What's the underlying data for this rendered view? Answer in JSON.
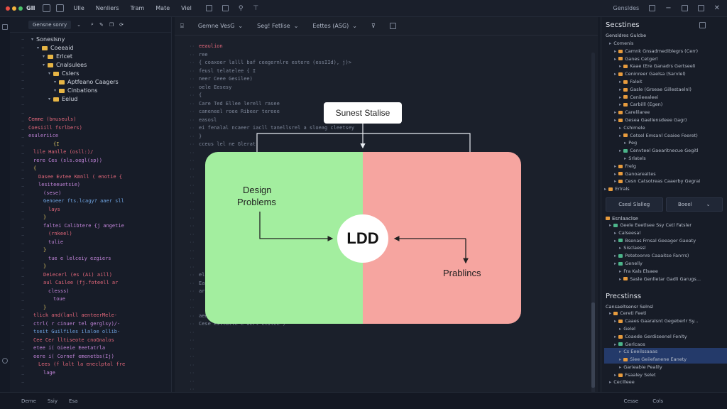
{
  "titlebar": {
    "app_name": "GII",
    "menu": [
      "Ulle",
      "Nenliers",
      "Tram",
      "Mate",
      "Viel"
    ],
    "right_label": "Gensldes",
    "dot_colors": [
      "#e94f45",
      "#f2b33d",
      "#4cc36b"
    ]
  },
  "explorer": {
    "header_label": "Gensne sonry",
    "tree": [
      {
        "label": "Soneslsny",
        "indent": 0,
        "folder": false
      },
      {
        "label": "Coeeaid",
        "indent": 1,
        "folder": true
      },
      {
        "label": "Erlcet",
        "indent": 2,
        "folder": true
      },
      {
        "label": "Cnalsulees",
        "indent": 2,
        "folder": true
      },
      {
        "label": "Cslers",
        "indent": 3,
        "folder": true
      },
      {
        "label": "Aptfeano Caagers",
        "indent": 4,
        "folder": true
      },
      {
        "label": "Cinbations",
        "indent": 4,
        "folder": true
      },
      {
        "label": "Eelud",
        "indent": 3,
        "folder": true
      }
    ],
    "code_lines": [
      {
        "t": "Cemme (bnuseuls)",
        "c": "c-red",
        "i": 0
      },
      {
        "t": "Coesiill fsrlbers)",
        "c": "c-red",
        "i": 0
      },
      {
        "t": "esuleriice",
        "c": "c-pur",
        "i": 0
      },
      {
        "t": "{I",
        "c": "c-yel",
        "i": 5
      },
      {
        "t": "lile Hanlle (osll:)/",
        "c": "c-red",
        "i": 1
      },
      {
        "t": "rere Ces (sls.oegl(sp))",
        "c": "c-pur",
        "i": 1
      },
      {
        "t": "{",
        "c": "c-yel",
        "i": 1
      },
      {
        "t": "Dasee Evtee Kmnll ( enotie {",
        "c": "c-red",
        "i": 2
      },
      {
        "t": "lesiteeuetsie)",
        "c": "c-pur",
        "i": 2
      },
      {
        "t": "(sese)",
        "c": "c-pur",
        "i": 3
      },
      {
        "t": "Genoeer fts.lcagy? aaer sll",
        "c": "c-blu",
        "i": 3
      },
      {
        "t": "lays",
        "c": "c-red",
        "i": 4
      },
      {
        "t": "}",
        "c": "c-yel",
        "i": 3
      },
      {
        "t": "faltei Calibtere {j angetie",
        "c": "c-pur",
        "i": 3
      },
      {
        "t": "(rnkeel)",
        "c": "c-red",
        "i": 4
      },
      {
        "t": "tulie",
        "c": "c-pur",
        "i": 4
      },
      {
        "t": "}",
        "c": "c-yel",
        "i": 3
      },
      {
        "t": "tue e lelceiy ezgiers",
        "c": "c-pur",
        "i": 4
      },
      {
        "t": "}",
        "c": "c-yel",
        "i": 3
      },
      {
        "t": "Deiecerl (es (Ai) aill)",
        "c": "c-red",
        "i": 3
      },
      {
        "t": "aul Cailee (fj.foteell ar",
        "c": "c-red",
        "i": 3
      },
      {
        "t": "clesss)",
        "c": "c-pur",
        "i": 4
      },
      {
        "t": "toue",
        "c": "c-pur",
        "i": 5
      },
      {
        "t": "}",
        "c": "c-yel",
        "i": 3
      },
      {
        "t": "",
        "c": "c-gry",
        "i": 0
      },
      {
        "t": "tlick and(lanll aenteerMele-",
        "c": "c-red",
        "i": 1
      },
      {
        "t": "ctrl( r cinuer tel gerglsy)/-",
        "c": "c-pur",
        "i": 1
      },
      {
        "t": "tseit Guilfiles ilaloe ollib-",
        "c": "c-blu",
        "i": 1
      },
      {
        "t": "",
        "c": "c-gry",
        "i": 0
      },
      {
        "t": "Cee Cer lltiseote cnoGnalos",
        "c": "c-red",
        "i": 1
      },
      {
        "t": "etee i( Gieeie Eeetatrla",
        "c": "c-pur",
        "i": 1
      },
      {
        "t": "eere i( Cornef emenetbs(Ij)",
        "c": "c-pur",
        "i": 1
      },
      {
        "t": "Lees (f lalt la eneclptal fre",
        "c": "c-red",
        "i": 2
      },
      {
        "t": "lage",
        "c": "c-pur",
        "i": 3
      }
    ]
  },
  "editor": {
    "tabs": [
      "Gemne VesG",
      "Seg! Fetlise",
      "Eettes (ASG)"
    ],
    "code_lines": [
      {
        "t": "eeaulion",
        "c": "c-red"
      },
      {
        "t": "ree",
        "c": "c-gry"
      },
      {
        "t": "{ coaxoer lalll baf ceegernlre estere (essIId), j)>",
        "c": "c-gry"
      },
      {
        "t": "   feusl telatelee {    I",
        "c": "c-gry"
      },
      {
        "t": "     neer Ceee Gesilee)",
        "c": "c-gry"
      },
      {
        "t": "     oele Eesesy",
        "c": "c-gry"
      },
      {
        "t": "   {",
        "c": "c-gry"
      },
      {
        "t": "     Care Ted Ellee lerell rasee",
        "c": "c-gry"
      },
      {
        "t": "     caneneel roee  Ribeer tereee",
        "c": "c-gry"
      },
      {
        "t": "     easosl",
        "c": "c-gry"
      },
      {
        "t": "        ei fenalal ncaeer iacll tanellsrel a sloeag cleetsey",
        "c": "c-gry"
      },
      {
        "t": "     }",
        "c": "c-gry"
      },
      {
        "t": "        cceus lel  ne   Glerat",
        "c": "c-gry"
      },
      {
        "t": "",
        "c": "c-gry"
      },
      {
        "t": "",
        "c": "c-gry"
      },
      {
        "t": "",
        "c": "c-gry"
      },
      {
        "t": "",
        "c": "c-gry"
      },
      {
        "t": "",
        "c": "c-gry"
      },
      {
        "t": "",
        "c": "c-gry"
      },
      {
        "t": "",
        "c": "c-gry"
      },
      {
        "t": "",
        "c": "c-gry"
      },
      {
        "t": "",
        "c": "c-gry"
      },
      {
        "t": "",
        "c": "c-gry"
      },
      {
        "t": "",
        "c": "c-gry"
      },
      {
        "t": "",
        "c": "c-gry"
      },
      {
        "t": "",
        "c": "c-gry"
      },
      {
        "t": "",
        "c": "c-gry"
      },
      {
        "t": "",
        "c": "c-gry"
      },
      {
        "t": "   eluu lesiteee)",
        "c": "c-gry"
      },
      {
        "t": "   Easss hesk esselae)",
        "c": "c-gry"
      },
      {
        "t": "     ar Ess Eeil, Geaepaeer ilie III)",
        "c": "c-gry"
      },
      {
        "t": "",
        "c": "c-gry"
      },
      {
        "t": "",
        "c": "c-gry"
      },
      {
        "t": "   aeetnotlon (seeeinem, Isll)",
        "c": "c-gry"
      },
      {
        "t": "   Cese estlalle e oerl elilee  )",
        "c": "c-gry"
      }
    ]
  },
  "diagram": {
    "callout": "Sunest Stalise",
    "hub": "LDD",
    "left_label_1": "Design",
    "left_label_2": "Problems",
    "right_label": "Prablincs",
    "colors": {
      "green": "#a3ee9f",
      "pink": "#f6a5a0"
    }
  },
  "right_panel": {
    "title": "Secstines",
    "section_top": "Gensldres Gulcbe",
    "list1": [
      {
        "t": "Comenis",
        "ic": "",
        "i": 1
      },
      {
        "t": "Camnk Gnsadmediblegrs (Cerr)",
        "ic": "o",
        "i": 2
      },
      {
        "t": "Ganes Cetgerl",
        "ic": "o",
        "i": 2
      },
      {
        "t": "Kaae (Ere Ganadrs Gertseeli",
        "ic": "o",
        "i": 3
      },
      {
        "t": "Ceninreer Gaelsa (Sarvlel)",
        "ic": "o",
        "i": 2
      },
      {
        "t": "Faleit",
        "ic": "o",
        "i": 3
      },
      {
        "t": "Gasle (Grseae Gillestaelnl)",
        "ic": "o",
        "i": 3
      },
      {
        "t": "Ceniieealeei",
        "ic": "o",
        "i": 3
      },
      {
        "t": "Carbilll (Egen)",
        "ic": "o",
        "i": 3
      },
      {
        "t": "Carelilaree",
        "ic": "o",
        "i": 2
      },
      {
        "t": "Gesea Gaellensdeee Gagr)",
        "ic": "o",
        "i": 2
      },
      {
        "t": "Cshirnele",
        "ic": "",
        "i": 3
      },
      {
        "t": "Cetsel Emsanl Ceaiee Feeret)",
        "ic": "o",
        "i": 3
      },
      {
        "t": "Peg",
        "ic": "",
        "i": 4
      },
      {
        "t": "Cenvteel Gaearitnecue Gegitl",
        "ic": "g",
        "i": 3
      },
      {
        "t": "Srlatels",
        "ic": "",
        "i": 4
      },
      {
        "t": "Frelg",
        "ic": "o",
        "i": 2
      },
      {
        "t": "Ganoarealtes",
        "ic": "o",
        "i": 2
      },
      {
        "t": "Cesn Catsotreas Caaerby Gegrai",
        "ic": "o",
        "i": 2
      },
      {
        "t": "Erlrals",
        "ic": "o",
        "i": 0
      }
    ],
    "btn1": "Csesl Slalleg",
    "btn2": "Boeel",
    "list2_head": "Esnlaaclse",
    "list2": [
      {
        "t": "Geele Eeetlsee Ssy Cetl Fatsler",
        "ic": "g",
        "i": 1
      },
      {
        "t": "Calseesal",
        "ic": "",
        "i": 2
      },
      {
        "t": "Bsenas Frnsal Geeager Gaeaty",
        "ic": "g",
        "i": 2
      },
      {
        "t": "Sisclaessl",
        "ic": "",
        "i": 3
      },
      {
        "t": "Petetoonre Caaaitse Fanrrs)",
        "ic": "g",
        "i": 2
      },
      {
        "t": "Genelly",
        "ic": "g",
        "i": 2
      },
      {
        "t": "Fra Kals Elsaee",
        "ic": "",
        "i": 3
      },
      {
        "t": "Sasle Genlletar Gadli Garugs...",
        "ic": "o",
        "i": 3
      }
    ],
    "title2": "Precstinss",
    "section2": "Cansaeltsensr Selnsl",
    "list3": [
      {
        "t": "Cereti Feeti",
        "ic": "o",
        "i": 1
      },
      {
        "t": "Caaes Gaaralsnt Gegeberlr Sy...",
        "ic": "o",
        "i": 2
      },
      {
        "t": "Gelel",
        "ic": "",
        "i": 3
      },
      {
        "t": "Coaede Gerdiseenel Fenlty",
        "ic": "o",
        "i": 2
      },
      {
        "t": "Gerlcaos",
        "ic": "g",
        "i": 2
      },
      {
        "t": "Cs Eeeilssaaas",
        "ic": "",
        "i": 3,
        "sel": true
      },
      {
        "t": "Siee Geiiefanene Eanety",
        "ic": "o",
        "i": 3,
        "sel": true
      },
      {
        "t": "Garieabie Pealily",
        "ic": "",
        "i": 3
      },
      {
        "t": "Fsaaley Selet",
        "ic": "o",
        "i": 2
      },
      {
        "t": "Cecilleee",
        "ic": "",
        "i": 1
      }
    ]
  },
  "status": {
    "left": [
      "Deme",
      "Ssiy",
      "Esa"
    ],
    "right": [
      "Cesse",
      "Cols"
    ]
  }
}
